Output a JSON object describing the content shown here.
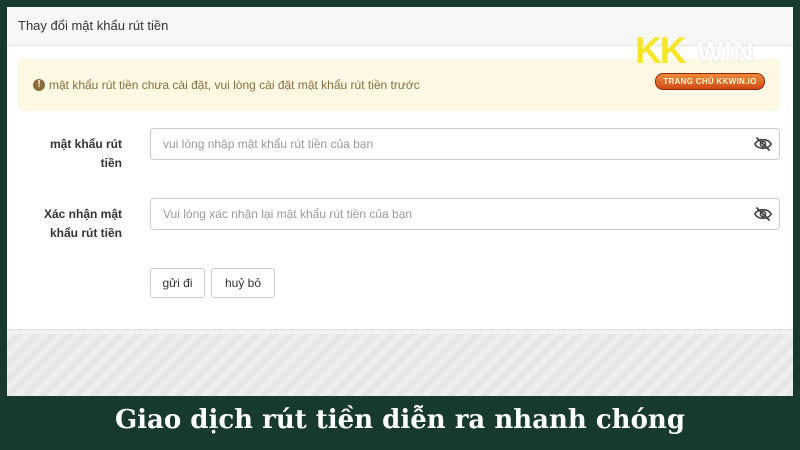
{
  "panel": {
    "title": "Thay đổi mật khẩu rút tiền"
  },
  "alert": {
    "icon": "exclamation-circle-icon",
    "text": "mật khẩu rút tiền chưa cài đặt, vui lòng cài đặt mật khẩu rút tiền trước"
  },
  "form": {
    "password": {
      "label_line1": "mật khẩu rút",
      "label_line2": "tiền",
      "placeholder": "vui lòng nhập mật khẩu rút tiền của bạn",
      "value": ""
    },
    "confirm": {
      "label_line1": "Xác nhận mật",
      "label_line2": "khẩu rút tiền",
      "placeholder": "Vui lòng xác nhận lại mật khẩu rút tiền của bạn",
      "value": ""
    },
    "submit_label": "gửi đi",
    "cancel_label": "huỷ bỏ"
  },
  "logo": {
    "text_kk": "KK",
    "text_win": "WIN",
    "badge": "TRANG CHỦ KKWIN.IO"
  },
  "caption": "Giao dịch rút tiền diễn ra nhanh chóng",
  "colors": {
    "background": "#173a2c",
    "alert_bg": "#fcf8e3",
    "alert_text": "#8a6d3b",
    "logo_yellow": "#f5e629",
    "badge_orange": "#e0662a"
  }
}
